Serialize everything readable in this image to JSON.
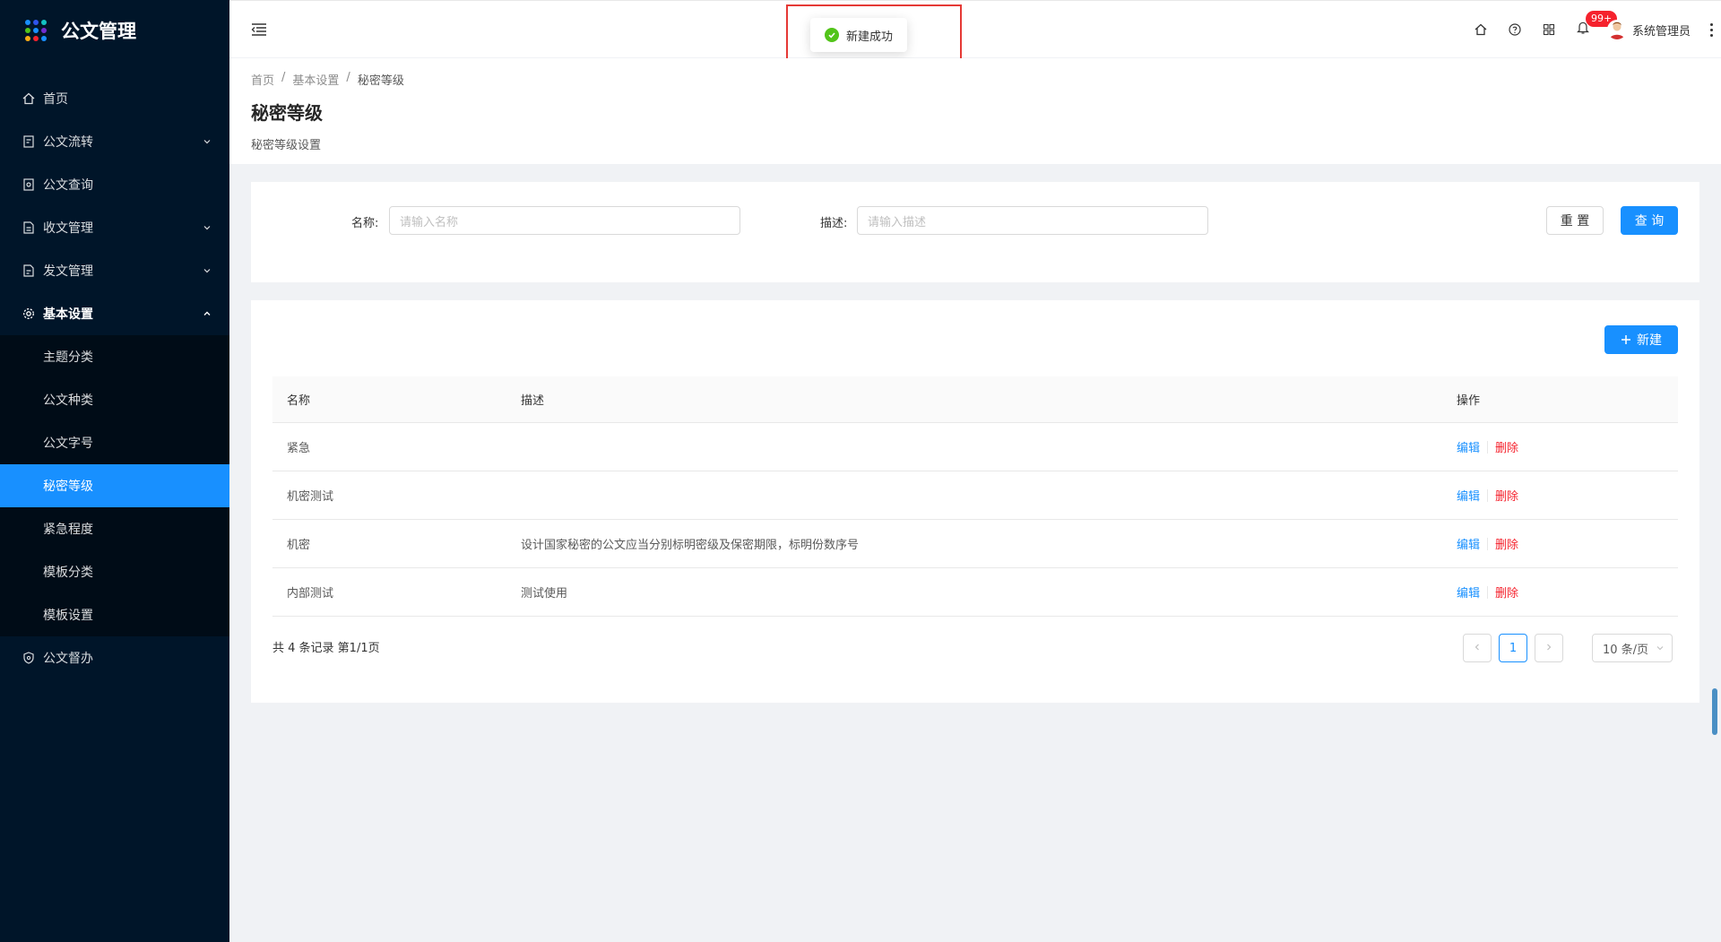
{
  "app": {
    "title": "公文管理"
  },
  "sidebar": {
    "items": [
      {
        "label": "首页",
        "icon": "home-icon"
      },
      {
        "label": "公文流转",
        "icon": "document-flow-icon"
      },
      {
        "label": "公文查询",
        "icon": "document-search-icon"
      },
      {
        "label": "收文管理",
        "icon": "inbox-document-icon"
      },
      {
        "label": "发文管理",
        "icon": "outbox-document-icon"
      },
      {
        "label": "基本设置",
        "icon": "gear-icon"
      },
      {
        "label": "公文督办",
        "icon": "shield-icon"
      }
    ],
    "submenu": [
      {
        "label": "主题分类"
      },
      {
        "label": "公文种类"
      },
      {
        "label": "公文字号"
      },
      {
        "label": "秘密等级"
      },
      {
        "label": "紧急程度"
      },
      {
        "label": "模板分类"
      },
      {
        "label": "模板设置"
      }
    ]
  },
  "header": {
    "notification_badge": "99+",
    "user_name": "系统管理员"
  },
  "toast": {
    "message": "新建成功"
  },
  "breadcrumb": [
    "首页",
    "基本设置",
    "秘密等级"
  ],
  "page": {
    "title": "秘密等级",
    "description": "秘密等级设置"
  },
  "search": {
    "name_label": "名称:",
    "name_placeholder": "请输入名称",
    "desc_label": "描述:",
    "desc_placeholder": "请输入描述",
    "reset_label": "重 置",
    "query_label": "查 询"
  },
  "table": {
    "new_label": "新建",
    "columns": [
      "名称",
      "描述",
      "操作"
    ],
    "edit_label": "编辑",
    "delete_label": "删除",
    "rows": [
      {
        "name": "紧急",
        "desc": ""
      },
      {
        "name": "机密测试",
        "desc": ""
      },
      {
        "name": "机密",
        "desc": "设计国家秘密的公文应当分别标明密级及保密期限，标明份数序号"
      },
      {
        "name": "内部测试",
        "desc": "测试使用"
      }
    ],
    "total_text": "共 4 条记录 第1/1页",
    "current_page": "1",
    "page_size": "10 条/页"
  },
  "colors": {
    "accent": "#1890ff",
    "sidebar_bg": "#001529",
    "danger": "#f5222d",
    "success": "#52c41a"
  }
}
